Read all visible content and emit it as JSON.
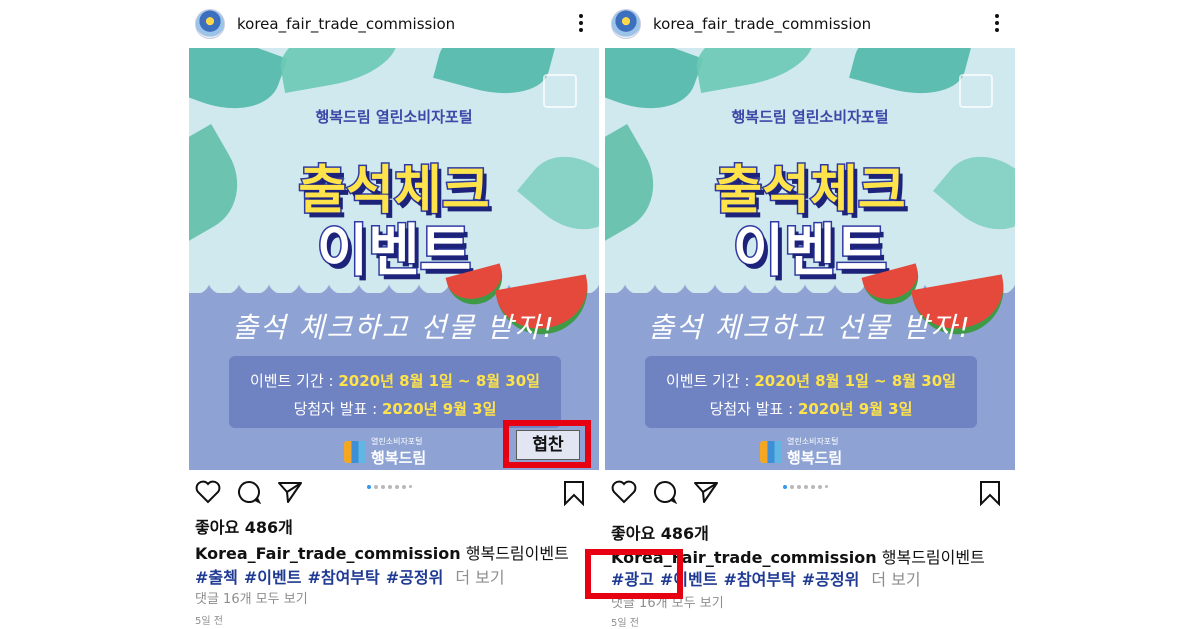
{
  "left_post": {
    "username": "korea_fair_trade_commission",
    "image": {
      "subtitle": "행복드림 열린소비자포털",
      "title_line1": "출석체크",
      "title_line2": "이벤트",
      "slogan": "출석 체크하고 선물 받자!",
      "period_label": "이벤트 기간 : ",
      "period_value": "2020년 8월 1일 ~ 8월 30일",
      "announce_label": "당첨자 발표 : ",
      "announce_value": "2020년 9월 3일",
      "logo_small": "열린소비자포털",
      "logo_big": "행복드림"
    },
    "sponsor_tag": "협찬",
    "likes": "좋아요 486개",
    "caption_user": "Korea_Fair_trade_commission",
    "caption_text": "행복드림이벤트",
    "hashtags": [
      "#출첵",
      "#이벤트",
      "#참여부탁",
      "#공정위"
    ],
    "more_label": "더 보기",
    "comments_label": "댓글 16개 모두 보기",
    "time_ago": "5일 전"
  },
  "right_post": {
    "username": "korea_fair_trade_commission",
    "image": {
      "subtitle": "행복드림 열린소비자포털",
      "title_line1": "출석체크",
      "title_line2": "이벤트",
      "slogan": "출석 체크하고 선물 받자!",
      "period_label": "이벤트 기간 : ",
      "period_value": "2020년 8월 1일 ~ 8월 30일",
      "announce_label": "당첨자 발표 : ",
      "announce_value": "2020년 9월 3일",
      "logo_small": "열린소비자포털",
      "logo_big": "행복드림"
    },
    "likes": "좋아요 486개",
    "caption_user": "Korea_Fair_trade_commission",
    "caption_text": "행복드림이벤트",
    "hashtags": [
      "#광고",
      "#이벤트",
      "#참여부탁",
      "#공정위"
    ],
    "more_label": "더 보기",
    "comments_label": "댓글 16개 모두 보기",
    "time_ago": "5일 전"
  },
  "colors": {
    "highlight_box": "#e60012",
    "hashtag": "#1f3a93",
    "muted": "#8e8e8e",
    "carousel_active": "#3897f0"
  },
  "icons": [
    "heart-icon",
    "comment-icon",
    "share-icon",
    "bookmark-icon",
    "more-options-icon"
  ]
}
